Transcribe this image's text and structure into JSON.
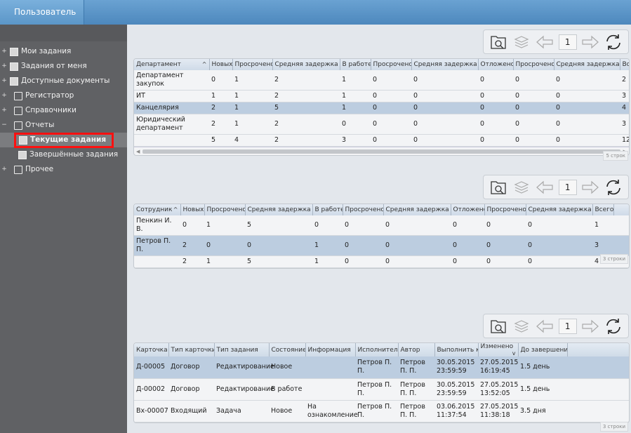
{
  "header": {
    "user_tab": "Пользователь"
  },
  "sidebar": {
    "items": [
      {
        "label": "Мои задания",
        "icon": "document-icon",
        "expander": "+"
      },
      {
        "label": "Задания от меня",
        "icon": "document-icon",
        "expander": "+"
      },
      {
        "label": "Доступные документы",
        "icon": "document-icon",
        "expander": "+"
      },
      {
        "label": "Регистратор",
        "icon": "folder-icon",
        "expander": "+"
      },
      {
        "label": "Справочники",
        "icon": "folder-icon",
        "expander": "+"
      },
      {
        "label": "Отчеты",
        "icon": "folder-open-icon",
        "expander": "−"
      },
      {
        "label": "Текущие задания",
        "icon": "document-icon",
        "sub": true,
        "active": true
      },
      {
        "label": "Завершённые задания",
        "icon": "document-icon",
        "sub": true
      },
      {
        "label": "Прочее",
        "icon": "folder-icon",
        "expander": "+"
      }
    ]
  },
  "toolbar": {
    "page": "1",
    "icons": [
      "folder-search-icon",
      "layers-icon",
      "arrow-left-icon",
      "arrow-right-icon",
      "refresh-icon"
    ]
  },
  "table1": {
    "columns": [
      "Департамент",
      "Новых",
      "Просрочено",
      "Средняя задержка (ч)",
      "В работе",
      "Просрочено",
      "Средняя задержка (ч)",
      "Отложено",
      "Просрочено",
      "Средняя задержка (ч)",
      "Всего"
    ],
    "rows": [
      [
        "Департамент закупок",
        "0",
        "1",
        "2",
        "1",
        "0",
        "0",
        "0",
        "0",
        "0",
        "2"
      ],
      [
        "ИТ",
        "1",
        "1",
        "2",
        "1",
        "0",
        "0",
        "0",
        "0",
        "0",
        "3"
      ],
      [
        "Канцелярия",
        "2",
        "1",
        "5",
        "1",
        "0",
        "0",
        "0",
        "0",
        "0",
        "4"
      ],
      [
        "Юридический департамент",
        "2",
        "1",
        "2",
        "0",
        "0",
        "0",
        "0",
        "0",
        "0",
        "3"
      ],
      [
        "",
        "5",
        "4",
        "2",
        "3",
        "0",
        "0",
        "0",
        "0",
        "0",
        "12"
      ]
    ],
    "selected_row": 2,
    "count": "5 строк"
  },
  "table2": {
    "columns": [
      "Сотрудник",
      "Новых",
      "Просрочено",
      "Средняя задержка (ч)",
      "В работе",
      "Просрочено",
      "Средняя задержка (ч)",
      "Отложено",
      "Просрочено",
      "Средняя задержка (ч)",
      "Всего"
    ],
    "rows": [
      [
        "Пенкин И. В.",
        "0",
        "1",
        "5",
        "0",
        "0",
        "0",
        "0",
        "0",
        "0",
        "1"
      ],
      [
        "Петров П. П.",
        "2",
        "0",
        "0",
        "1",
        "0",
        "0",
        "0",
        "0",
        "0",
        "3"
      ],
      [
        "",
        "2",
        "1",
        "5",
        "1",
        "0",
        "0",
        "0",
        "0",
        "0",
        "4"
      ]
    ],
    "selected_row": 1,
    "count": "3 строки"
  },
  "table3": {
    "columns": [
      "Карточка",
      "Тип карточки",
      "Тип задания",
      "Состояние",
      "Информация",
      "Исполнитель",
      "Автор",
      "Выполнить к",
      "Изменено",
      "До завершения"
    ],
    "rows": [
      [
        "Д-00005",
        "Договор",
        "Редактирование",
        "Новое",
        "",
        "Петров П. П.",
        "Петров П. П.",
        "30.05.2015 23:59:59",
        "27.05.2015 16:19:45",
        "1.5 день"
      ],
      [
        "Д-00002",
        "Договор",
        "Редактирование",
        "В работе",
        "",
        "Петров П. П.",
        "Петров П. П.",
        "30.05.2015 23:59:59",
        "27.05.2015 13:52:05",
        "1.5 день"
      ],
      [
        "Вх-00007",
        "Входящий",
        "Задача",
        "Новое",
        "На ознакомление",
        "Петров П. П.",
        "Петров П. П.",
        "03.06.2015 11:37:54",
        "27.05.2015 11:38:18",
        "3.5 дня"
      ]
    ],
    "selected_row": 0,
    "count": "3 строки"
  },
  "colors": {
    "topbar": "#4d88bd",
    "sidebar": "#606164",
    "selection": "#bccde0",
    "highlight_border": "#ff1010"
  }
}
